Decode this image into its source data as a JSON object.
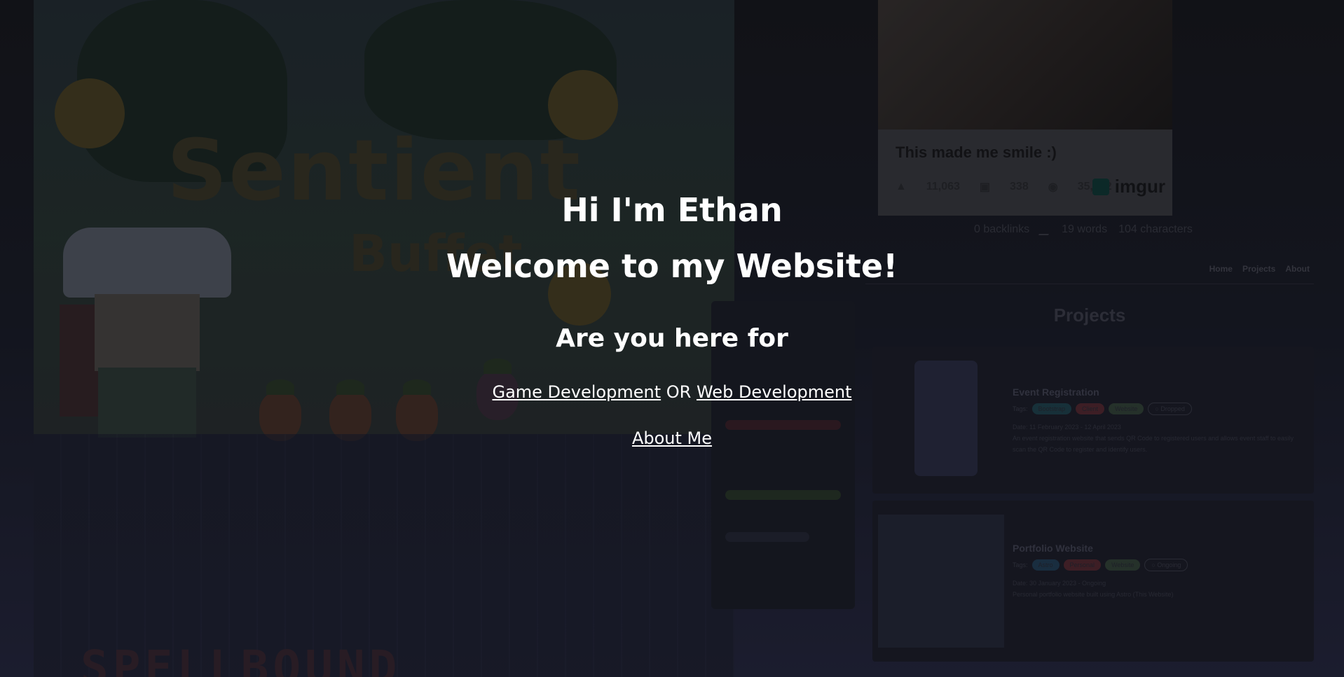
{
  "hero": {
    "greeting": "Hi I'm Ethan",
    "welcome": "Welcome to my Website!",
    "question": "Are you here for",
    "game_link": "Game Development",
    "or_text": "OR",
    "web_link": "Web Development",
    "about_link": "About Me"
  },
  "background": {
    "game_title": "Sentient",
    "game_subtitle": "Buffet",
    "game_footer_title": "SPELLBOUND",
    "imgur": {
      "caption": "This made me smile :)",
      "likes": "11,063",
      "comments": "338",
      "views": "35,462",
      "logo": "imgur"
    },
    "note_meta": {
      "backlinks": "0 backlinks",
      "words": "19 words",
      "characters": "104 characters"
    },
    "portfolio": {
      "nav": [
        "Home",
        "Projects",
        "About"
      ],
      "title": "Projects",
      "projects": [
        {
          "title": "Event Registration",
          "tags_label": "Tags:",
          "tags": [
            "Bootstrap",
            "Client",
            "Website"
          ],
          "status": "○ Dropped",
          "date": "Date: 11 February 2023 - 12 April 2023",
          "description": "An event registration website that sends QR Code to registered users and allows event staff to easily scan the QR Code to register and identify users."
        },
        {
          "title": "Portfolio Website",
          "tags_label": "Tags:",
          "tags": [
            "Astro",
            "Personal",
            "Website"
          ],
          "status": "○ Ongoing",
          "date": "Date: 30 January 2023 - Ongoing",
          "description": "Personal portfolio website built using Astro (This Website)"
        }
      ]
    }
  },
  "colors": {
    "overlay_text": "#ffffff",
    "tag_teal": "#1f4650",
    "tag_red": "#5a2a32",
    "tag_green": "#35473a",
    "tag_blue": "#22415a"
  }
}
